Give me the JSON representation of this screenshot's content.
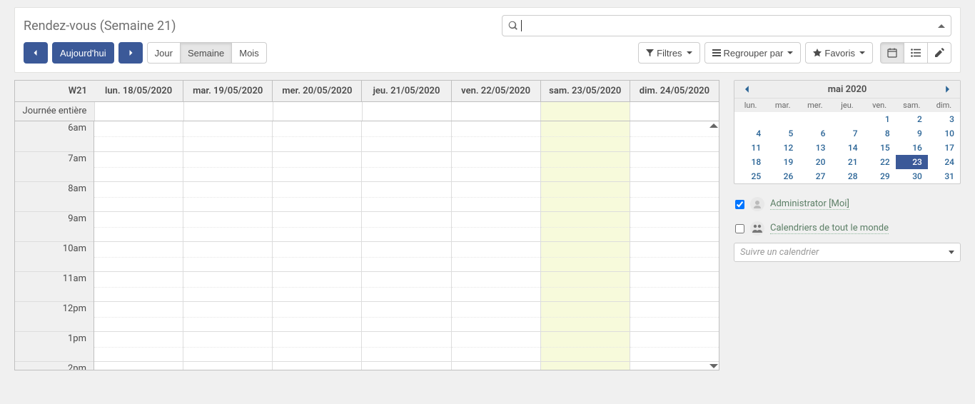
{
  "title": "Rendez-vous (Semaine 21)",
  "nav": {
    "today": "Aujourd'hui",
    "views": {
      "day": "Jour",
      "week": "Semaine",
      "month": "Mois"
    }
  },
  "toolbar": {
    "filters": "Filtres",
    "group_by": "Regrouper par",
    "favorites": "Favoris"
  },
  "calendar": {
    "week_label": "W21",
    "allday_label": "Journée entière",
    "days": [
      {
        "label": "lun. 18/05/2020",
        "today": false
      },
      {
        "label": "mar. 19/05/2020",
        "today": false
      },
      {
        "label": "mer. 20/05/2020",
        "today": false
      },
      {
        "label": "jeu. 21/05/2020",
        "today": false
      },
      {
        "label": "ven. 22/05/2020",
        "today": false
      },
      {
        "label": "sam. 23/05/2020",
        "today": true
      },
      {
        "label": "dim. 24/05/2020",
        "today": false
      }
    ],
    "hours": [
      "6am",
      "7am",
      "8am",
      "9am",
      "10am",
      "11am",
      "12pm",
      "1pm",
      "2pm"
    ]
  },
  "mini_calendar": {
    "title": "mai 2020",
    "dow": [
      "lun.",
      "mar.",
      "mer.",
      "jeu.",
      "ven.",
      "sam.",
      "dim."
    ],
    "weeks": [
      [
        "",
        "",
        "",
        "",
        "1",
        "2",
        "3"
      ],
      [
        "4",
        "5",
        "6",
        "7",
        "8",
        "9",
        "10"
      ],
      [
        "11",
        "12",
        "13",
        "14",
        "15",
        "16",
        "17"
      ],
      [
        "18",
        "19",
        "20",
        "21",
        "22",
        "23",
        "24"
      ],
      [
        "25",
        "26",
        "27",
        "28",
        "29",
        "30",
        "31"
      ]
    ],
    "today": "23"
  },
  "filters": {
    "items": [
      {
        "label": "Administrator [Moi]",
        "checked": true,
        "icon": "user"
      },
      {
        "label": "Calendriers de tout le monde",
        "checked": false,
        "icon": "users"
      }
    ],
    "follow_placeholder": "Suivre un calendrier"
  }
}
